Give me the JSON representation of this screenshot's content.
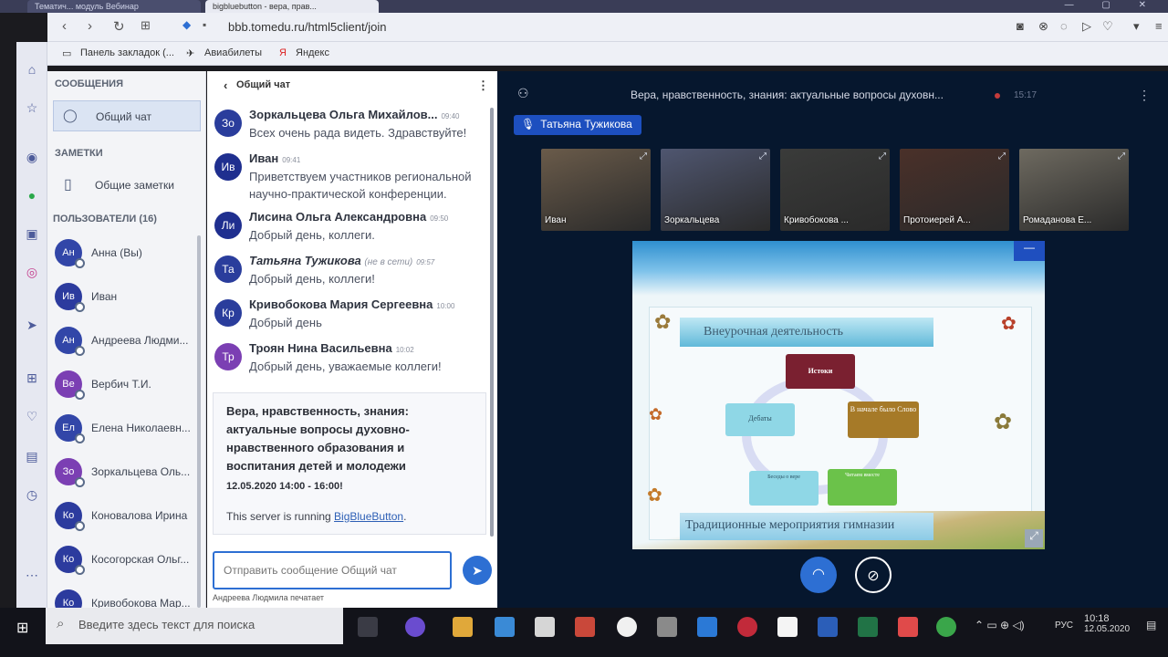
{
  "browser": {
    "tabs": [
      "Тематич... модуль Вебинар",
      "bigbluebutton - вера, прав..."
    ],
    "url": "bbb.tomedu.ru/html5client/join",
    "bookmarks": [
      "Панель закладок (...",
      "Авиабилеты",
      "Яндекс"
    ]
  },
  "userlist": {
    "messages_header": "СООБЩЕНИЯ",
    "public_chat": "Общий чат",
    "notes_header": "ЗАМЕТКИ",
    "shared_notes": "Общие заметки",
    "users_header": "ПОЛЬЗОВАТЕЛИ (16)",
    "users": [
      {
        "initials": "Ан",
        "name": "Анна (Вы)",
        "color": "#3246a8"
      },
      {
        "initials": "Ив",
        "name": "Иван",
        "color": "#2c3b9e"
      },
      {
        "initials": "Ан",
        "name": "Андреева Людми...",
        "color": "#3246a8"
      },
      {
        "initials": "Ве",
        "name": "Вербич Т.И.",
        "color": "#7b3fb3"
      },
      {
        "initials": "Ел",
        "name": "Елена Николаевн...",
        "color": "#3246a8"
      },
      {
        "initials": "Зо",
        "name": "Зоркальцева Оль...",
        "color": "#7b3fb3"
      },
      {
        "initials": "Ко",
        "name": "Коновалова Ирина",
        "color": "#2c3b9e"
      },
      {
        "initials": "Ко",
        "name": "Косогорская Ольг...",
        "color": "#2c3b9e"
      },
      {
        "initials": "Ко",
        "name": "Кривобокова Мар...",
        "color": "#2c3b9e"
      }
    ]
  },
  "chat": {
    "title": "Общий чат",
    "messages": [
      {
        "initials": "Зо",
        "name": "Зоркальцева Ольга Михайлов...",
        "time": "09:40",
        "text": "Всех очень рада видеть. Здравствуйте!",
        "color": "#2a3d9c"
      },
      {
        "initials": "Ив",
        "name": "Иван",
        "time": "09:41",
        "text": "Приветствуем участников региональной научно-практической конференции.",
        "color": "#1f2f8f"
      },
      {
        "initials": "Ли",
        "name": "Лисина Ольга Александровна",
        "time": "09:50",
        "text": "Добрый день, коллеги.",
        "color": "#1f2f8f"
      },
      {
        "initials": "Та",
        "name": "Татьяна Тужикова",
        "status": "(не в сети)",
        "time": "09:57",
        "text": "Добрый день, коллеги!",
        "color": "#2a3d9c"
      },
      {
        "initials": "Кр",
        "name": "Кривобокова Мария Сергеевна",
        "time": "10:00",
        "text": "Добрый день",
        "color": "#2a3d9c"
      },
      {
        "initials": "Тр",
        "name": "Троян Нина Васильевна",
        "time": "10:02",
        "text": "Добрый день, уважаемые коллеги!",
        "color": "#7b3fb3"
      }
    ],
    "welcome_title": "Вера, нравственность, знания: актуальные вопросы духовно-нравственного образования и воспитания детей и молодежи",
    "welcome_date": "12.05.2020 14:00 - 16:00!",
    "server_prefix": "This server is running ",
    "server_link": "BigBlueButton",
    "server_suffix": ".",
    "input_placeholder": "Отправить сообщение Общий чат",
    "typing": "Андреева Людмила печатает"
  },
  "stage": {
    "title": "Вера, нравственность, знания: актуальные вопросы духовн...",
    "time": "15:17",
    "talker": "Татьяна Тужикова",
    "cams": [
      {
        "name": "Иван",
        "color": "#6a5b4a"
      },
      {
        "name": "Зоркальцева",
        "color": "#4f5670"
      },
      {
        "name": "Кривобокова ...",
        "color": "#3a3b3a"
      },
      {
        "name": "Протоиерей А...",
        "color": "#4a3029"
      },
      {
        "name": "Ромаданова Е...",
        "color": "#6e6a60"
      }
    ],
    "slide": {
      "title": "Внеурочная деятельность",
      "boxes": [
        "Истоки",
        "В начале было Слово",
        "Дебаты",
        "Беседы о вере",
        "Читаем вместе"
      ],
      "footer": "Традиционные мероприятия гимназии"
    }
  },
  "taskbar": {
    "search_placeholder": "Введите здесь текст для поиска",
    "lang": "РУС",
    "clock_time": "10:18",
    "clock_date": "12.05.2020"
  }
}
